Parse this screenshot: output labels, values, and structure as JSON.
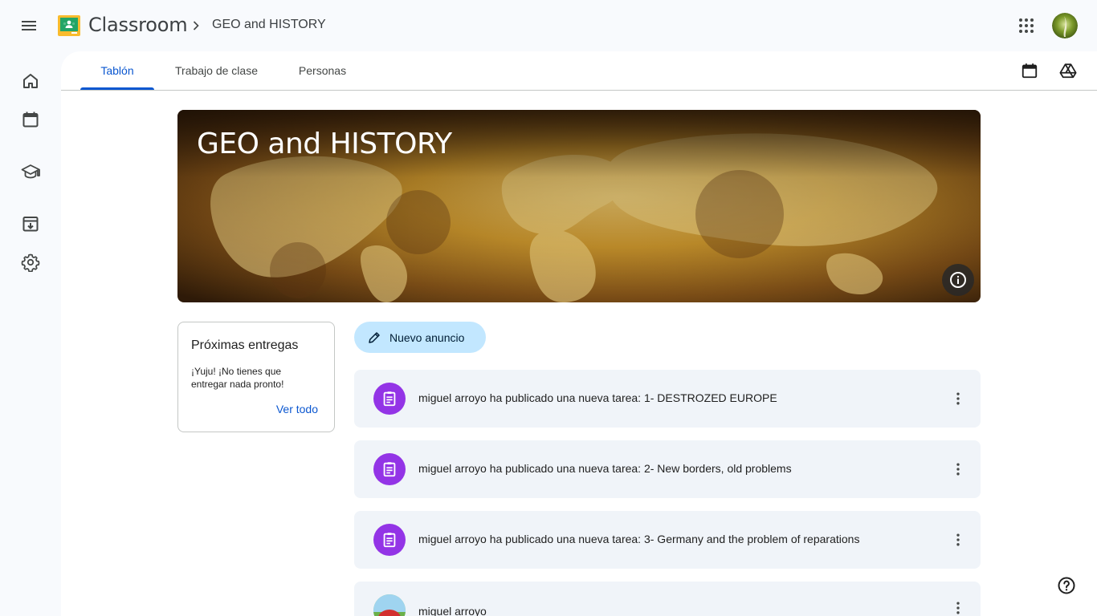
{
  "app": {
    "name": "Classroom",
    "class_name": "GEO and HISTORY"
  },
  "icons": {
    "menu": "menu-icon",
    "apps": "apps-grid-icon",
    "rail": [
      "home-icon",
      "calendar-icon",
      "graduation-cap-icon",
      "archive-icon",
      "settings-icon"
    ]
  },
  "tabs": [
    {
      "label": "Tablón",
      "active": true
    },
    {
      "label": "Trabajo de clase",
      "active": false
    },
    {
      "label": "Personas",
      "active": false
    }
  ],
  "banner": {
    "title": "GEO and HISTORY"
  },
  "upcoming": {
    "title": "Próximas entregas",
    "text": "¡Yuju! ¡No tienes que entregar nada pronto!",
    "link": "Ver todo"
  },
  "new_announcement": {
    "label": "Nuevo anuncio"
  },
  "stream": [
    {
      "text": "miguel arroyo ha publicado una nueva tarea: 1- DESTROZED EUROPE",
      "type": "assignment"
    },
    {
      "text": "miguel arroyo ha publicado una nueva tarea: 2- New borders, old problems",
      "type": "assignment"
    },
    {
      "text": "miguel arroyo ha publicado una nueva tarea: 3- Germany and the problem of reparations",
      "type": "assignment"
    },
    {
      "text": "miguel arroyo",
      "type": "post"
    }
  ],
  "colors": {
    "accent": "#0b57d0",
    "assignment": "#9334e6",
    "announce_bg": "#c2e7ff",
    "stream_bg": "#f0f4f9"
  }
}
